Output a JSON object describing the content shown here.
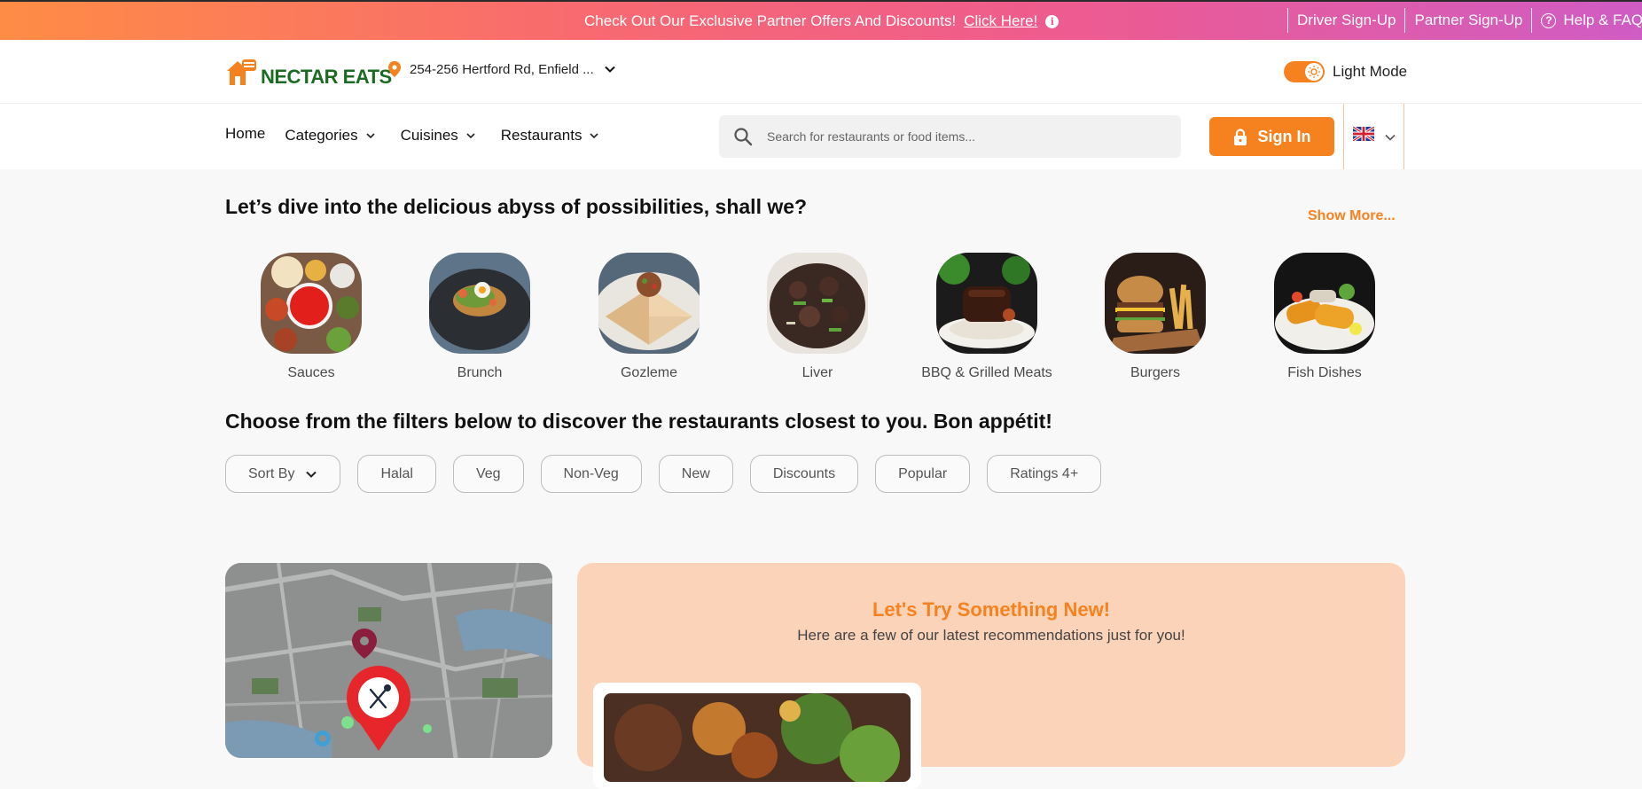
{
  "promo_bar": {
    "text": "Check Out Our Exclusive Partner Offers And Discounts!",
    "link": "Click Here!",
    "links": [
      "Driver Sign-Up",
      "Partner Sign-Up"
    ],
    "help": "Help & FAQs"
  },
  "header": {
    "brand": "NECTAR EATS",
    "address": "254-256 Hertford Rd, Enfield ...",
    "theme_label": "Light Mode"
  },
  "nav": {
    "items": [
      {
        "label": "Home"
      },
      {
        "label": "Categories"
      },
      {
        "label": "Cuisines"
      },
      {
        "label": "Restaurants"
      }
    ],
    "search_placeholder": "Search for restaurants or food items...",
    "sign_in": "Sign In"
  },
  "categories": {
    "heading": "Let’s dive into the delicious abyss of possibilities, shall we?",
    "show_more": "Show More...",
    "items": [
      {
        "label": "Sauces"
      },
      {
        "label": "Brunch"
      },
      {
        "label": "Gozleme"
      },
      {
        "label": "Liver"
      },
      {
        "label": "BBQ & Grilled Meats"
      },
      {
        "label": "Burgers"
      },
      {
        "label": "Fish Dishes"
      }
    ]
  },
  "filters": {
    "heading": "Choose from the filters below to discover the restaurants closest to you. Bon appétit!",
    "sort_by": "Sort By",
    "chips": [
      "Halal",
      "Veg",
      "Non-Veg",
      "New",
      "Discounts",
      "Popular",
      "Ratings 4+"
    ]
  },
  "recommendations": {
    "title": "Let's Try Something New!",
    "subtitle": "Here are a few of our latest recommendations just for you!"
  },
  "colors": {
    "accent": "#f5821f",
    "brand_green": "#1c6b22",
    "promo_gradient": [
      "#ff8c45",
      "#cf5cc4"
    ],
    "recommend_bg": "#fbd3b8"
  }
}
